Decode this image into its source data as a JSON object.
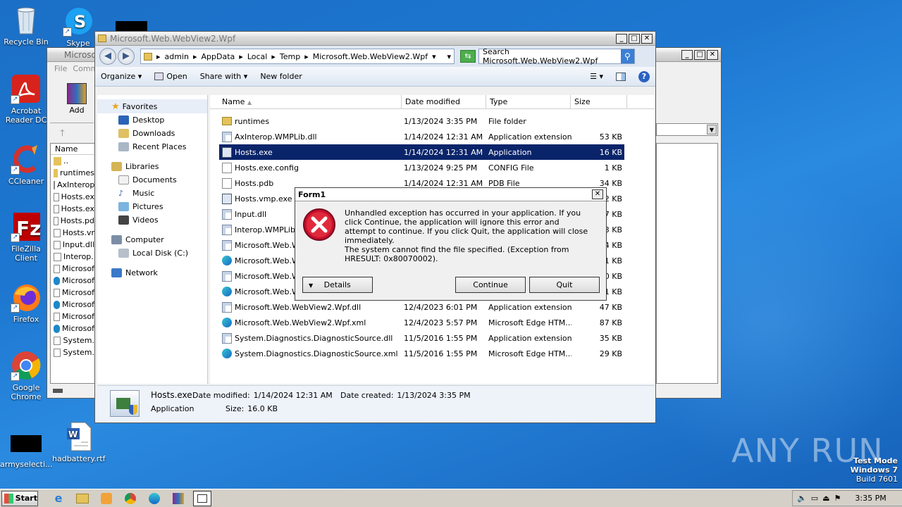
{
  "desktop": {
    "icons": [
      {
        "label": "Recycle Bin"
      },
      {
        "label": "Skype"
      },
      {
        "label": "Acrobat Reader DC"
      },
      {
        "label": "CCleaner"
      },
      {
        "label": "FileZilla Client"
      },
      {
        "label": "Firefox"
      },
      {
        "label": "Google Chrome"
      },
      {
        "label": "armyselecti..."
      },
      {
        "label": "hadbattery.rtf"
      }
    ],
    "watermark": "ANY RUN",
    "testmode": {
      "line1": "Test Mode",
      "line2": "Windows 7",
      "line3": "Build 7601"
    }
  },
  "backwin": {
    "title": "Microso",
    "menu_file": "File",
    "menu_comm": "Comm",
    "add_label": "Add",
    "name_col": "Name",
    "files": [
      "..",
      "runtimes",
      "AxInterop",
      "Hosts.ex",
      "Hosts.ex",
      "Hosts.pd",
      "Hosts.vr",
      "Input.dll",
      "Interop.",
      "Microsof",
      "Microsof",
      "Microsof",
      "Microsof",
      "Microsof",
      "Microsof",
      "System.",
      "System."
    ]
  },
  "explorer": {
    "title": "Microsoft.Web.WebView2.Wpf",
    "breadcrumb": [
      "admin",
      "AppData",
      "Local",
      "Temp",
      "Microsoft.Web.WebView2.Wpf"
    ],
    "search_placeholder": "Search Microsoft.Web.WebView2.Wpf",
    "toolbar": {
      "organize": "Organize",
      "open": "Open",
      "share": "Share with",
      "newfolder": "New folder"
    },
    "nav": {
      "favorites": "Favorites",
      "desktop": "Desktop",
      "downloads": "Downloads",
      "recent": "Recent Places",
      "libraries": "Libraries",
      "documents": "Documents",
      "music": "Music",
      "pictures": "Pictures",
      "videos": "Videos",
      "computer": "Computer",
      "localdisk": "Local Disk (C:)",
      "network": "Network"
    },
    "columns": {
      "name": "Name",
      "date": "Date modified",
      "type": "Type",
      "size": "Size"
    },
    "files": [
      {
        "name": "runtimes",
        "date": "1/13/2024 3:35 PM",
        "type": "File folder",
        "size": "",
        "icon": "folder"
      },
      {
        "name": "AxInterop.WMPLib.dll",
        "date": "1/14/2024 12:31 AM",
        "type": "Application extension",
        "size": "53 KB",
        "icon": "dll"
      },
      {
        "name": "Hosts.exe",
        "date": "1/14/2024 12:31 AM",
        "type": "Application",
        "size": "16 KB",
        "icon": "exe"
      },
      {
        "name": "Hosts.exe.config",
        "date": "1/13/2024 9:25 PM",
        "type": "CONFIG File",
        "size": "1 KB",
        "icon": "file"
      },
      {
        "name": "Hosts.pdb",
        "date": "1/14/2024 12:31 AM",
        "type": "PDB File",
        "size": "34 KB",
        "icon": "file"
      },
      {
        "name": "Hosts.vmp.exe",
        "date": "",
        "type": "",
        "size": "2 KB",
        "icon": "exe"
      },
      {
        "name": "Input.dll",
        "date": "",
        "type": "",
        "size": "7 KB",
        "icon": "dll"
      },
      {
        "name": "Interop.WMPLib.d",
        "date": "",
        "type": "",
        "size": "3 KB",
        "icon": "dll"
      },
      {
        "name": "Microsoft.Web.W",
        "date": "",
        "type": "",
        "size": "4 KB",
        "icon": "dll"
      },
      {
        "name": "Microsoft.Web.W",
        "date": "",
        "type": "",
        "size": "1 KB",
        "icon": "edge"
      },
      {
        "name": "Microsoft.Web.W",
        "date": "",
        "type": "",
        "size": "0 KB",
        "icon": "dll"
      },
      {
        "name": "Microsoft.Web.W",
        "date": "",
        "type": "",
        "size": "1 KB",
        "icon": "edge"
      },
      {
        "name": "Microsoft.Web.WebView2.Wpf.dll",
        "date": "12/4/2023 6:01 PM",
        "type": "Application extension",
        "size": "47 KB",
        "icon": "dll"
      },
      {
        "name": "Microsoft.Web.WebView2.Wpf.xml",
        "date": "12/4/2023 5:57 PM",
        "type": "Microsoft Edge HTM...",
        "size": "87 KB",
        "icon": "edge"
      },
      {
        "name": "System.Diagnostics.DiagnosticSource.dll",
        "date": "11/5/2016 1:55 PM",
        "type": "Application extension",
        "size": "35 KB",
        "icon": "dll"
      },
      {
        "name": "System.Diagnostics.DiagnosticSource.xml",
        "date": "11/5/2016 1:55 PM",
        "type": "Microsoft Edge HTM...",
        "size": "29 KB",
        "icon": "edge"
      }
    ],
    "details": {
      "filename": "Hosts.exe",
      "modified_label": "Date modified:",
      "modified": "1/14/2024 12:31 AM",
      "created_label": "Date created:",
      "created": "1/13/2024 3:35 PM",
      "kind": "Application",
      "size_label": "Size:",
      "size": "16.0 KB"
    }
  },
  "dialog": {
    "title": "Form1",
    "message1": "Unhandled exception has occurred in your application. If you click Continue, the application will ignore this error and attempt to continue. If you click Quit, the application will close immediately.",
    "message2": "The system cannot find the file specified. (Exception from HRESULT: 0x80070002).",
    "details": "Details",
    "continue": "Continue",
    "quit": "Quit"
  },
  "taskbar": {
    "start": "Start",
    "clock": "3:35 PM"
  }
}
